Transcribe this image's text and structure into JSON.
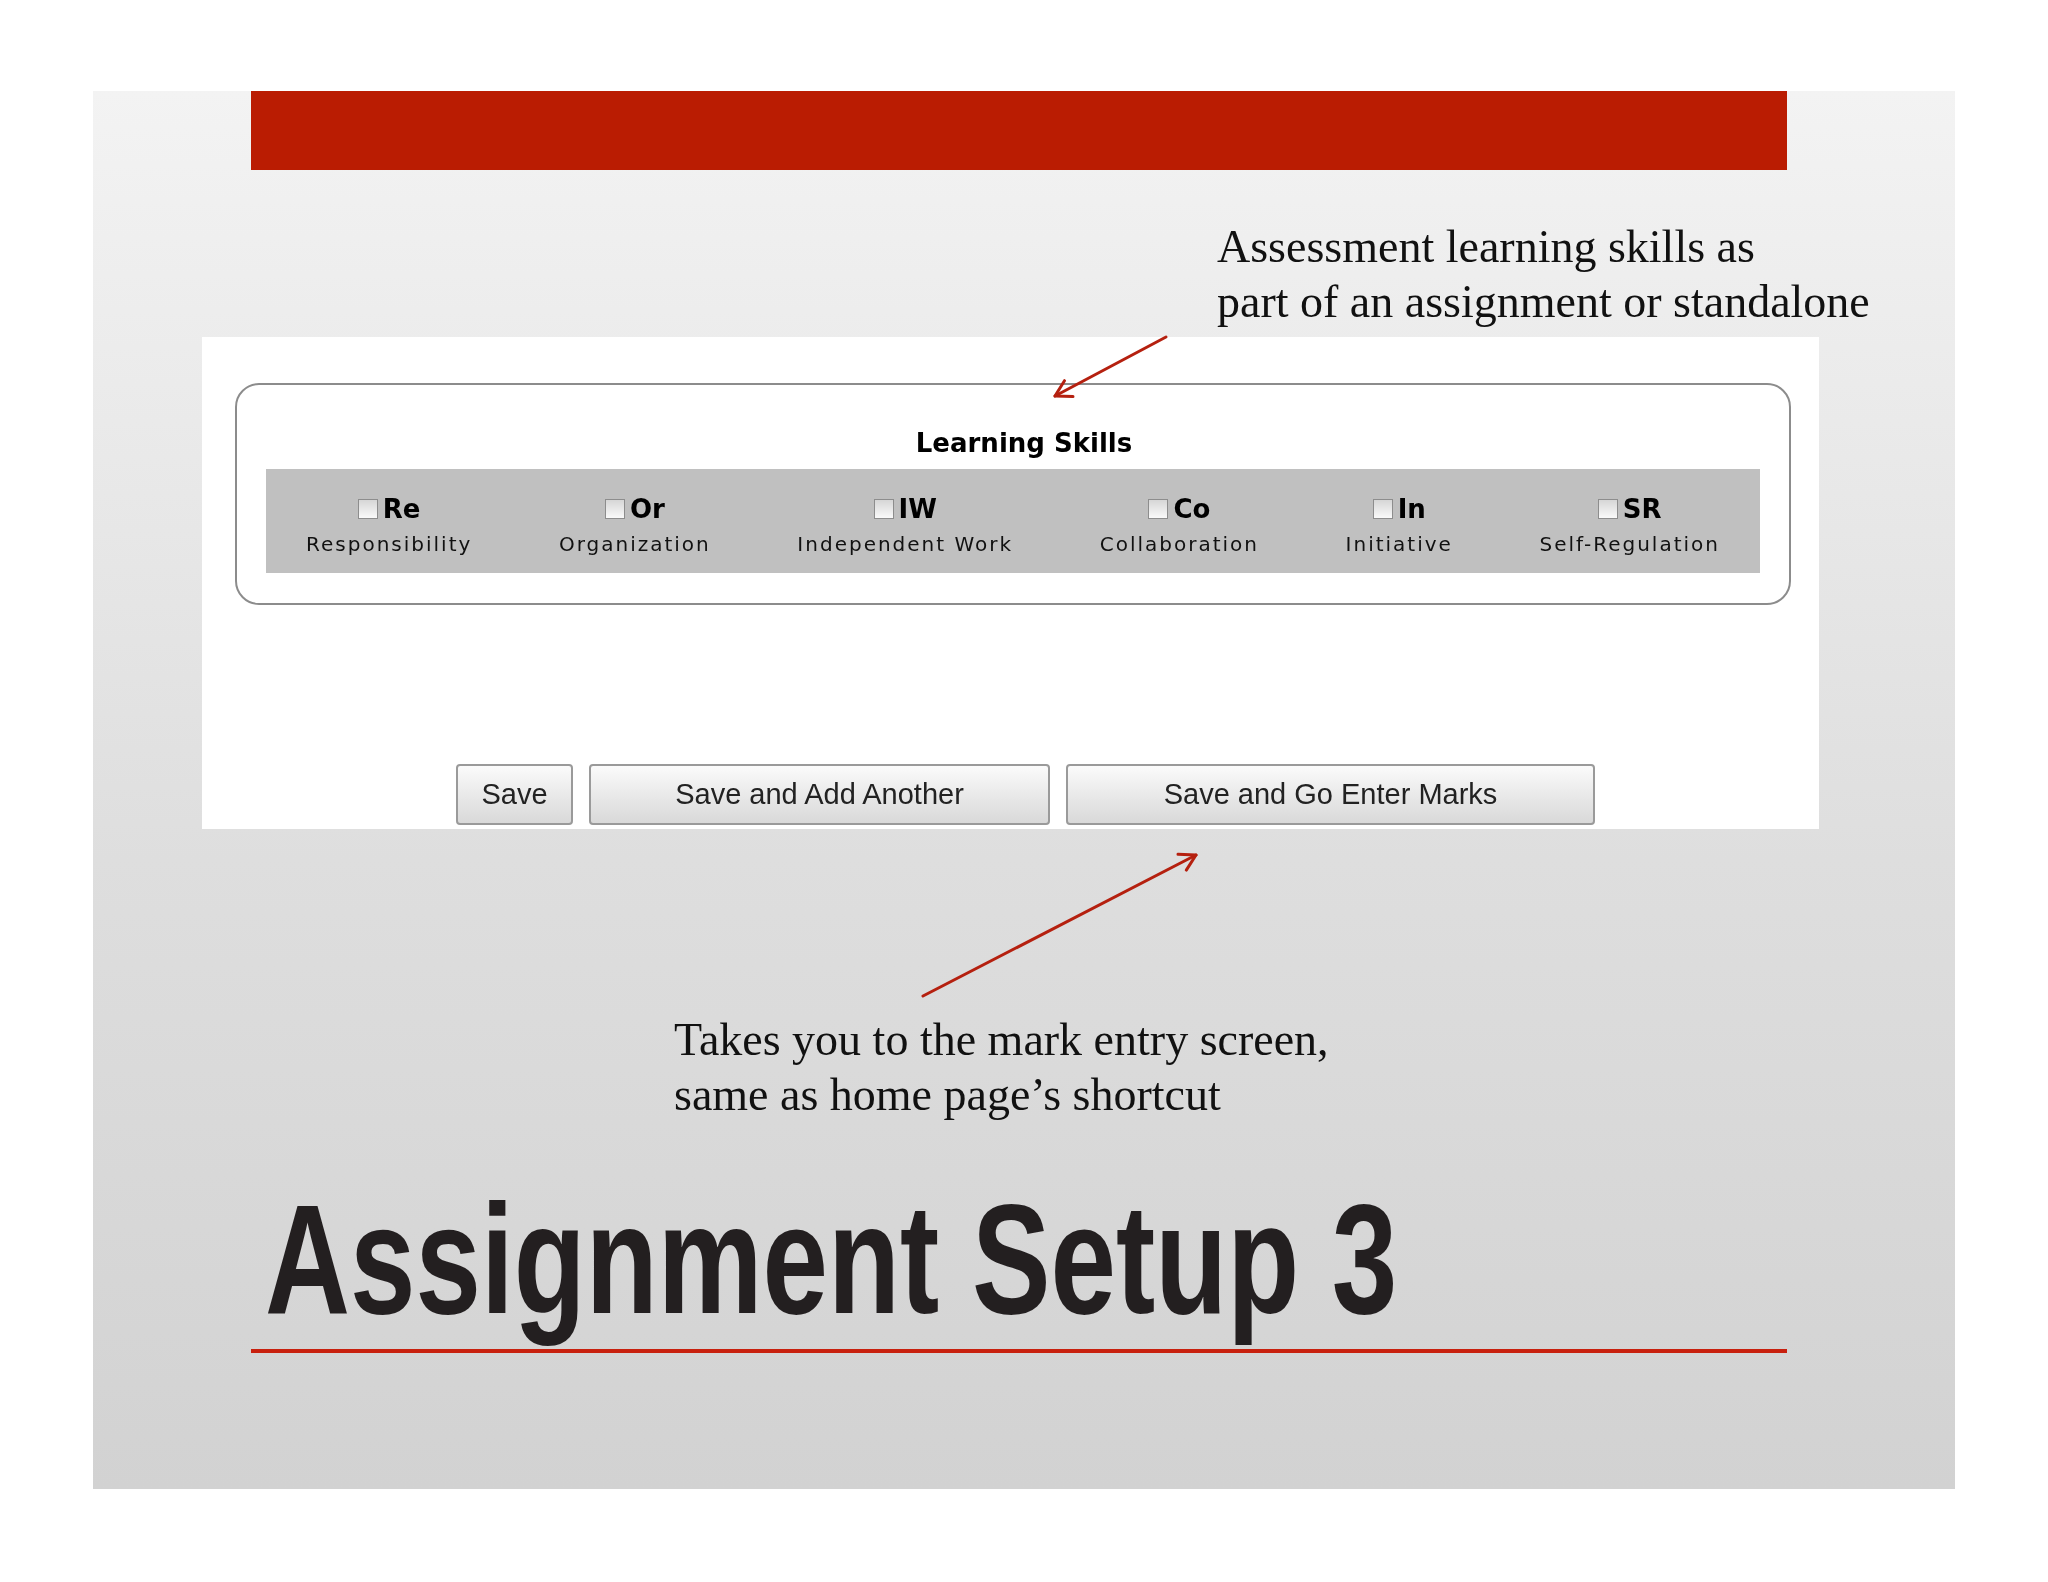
{
  "top_note": {
    "lines": [
      "Assessment learning skills as",
      "part of an assignment or standalone"
    ]
  },
  "form": {
    "legend": "Learning Skills",
    "skills": [
      {
        "code": "Re",
        "name": "Responsibility",
        "checked": false
      },
      {
        "code": "Or",
        "name": "Organization",
        "checked": false
      },
      {
        "code": "IW",
        "name": "Independent Work",
        "checked": false
      },
      {
        "code": "Co",
        "name": "Collaboration",
        "checked": false
      },
      {
        "code": "In",
        "name": "Initiative",
        "checked": false
      },
      {
        "code": "SR",
        "name": "Self-Regulation",
        "checked": false
      }
    ],
    "buttons": [
      "Save",
      "Save and Add Another",
      "Save and Go Enter Marks"
    ]
  },
  "bottom_note": {
    "lines": [
      "Takes you to the mark entry screen,",
      "same as home page’s shortcut"
    ]
  },
  "title": "Assignment Setup 3"
}
